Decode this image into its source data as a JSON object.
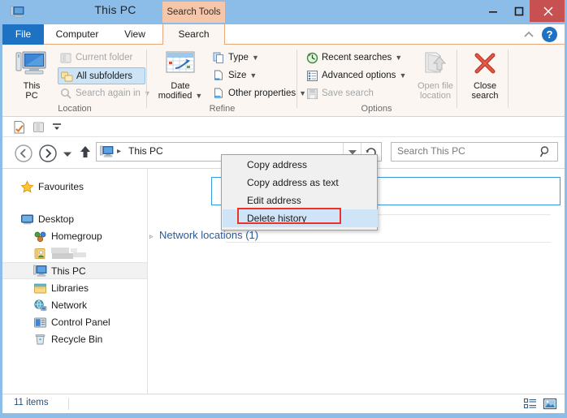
{
  "window": {
    "title": "This PC",
    "contextual_tab_header": "Search Tools",
    "icon": "this-pc-icon",
    "controls": {
      "minimize": "Minimize",
      "maximize": "Maximize",
      "close": "Close"
    },
    "help_label": "?",
    "accent_color": "#8cbde8",
    "close_color": "#c75050",
    "contextual_color": "#f6c6ab"
  },
  "tabs": [
    {
      "label": "File",
      "active": false,
      "style": "file"
    },
    {
      "label": "Computer",
      "active": false,
      "style": "normal"
    },
    {
      "label": "View",
      "active": false,
      "style": "normal"
    },
    {
      "label": "Search",
      "active": true,
      "style": "contextual"
    }
  ],
  "ribbon": {
    "groups": [
      {
        "name": "Location",
        "label": "Location",
        "big_button": {
          "label_line1": "This",
          "label_line2": "PC",
          "icon": "this-pc-icon"
        },
        "items": [
          {
            "label": "Current folder",
            "icon": "folder-icon",
            "disabled": true,
            "caret": false
          },
          {
            "label": "All subfolders",
            "icon": "subfolders-icon",
            "disabled": false,
            "caret": false,
            "checked": true
          },
          {
            "label": "Search again in",
            "icon": "search-again-icon",
            "disabled": true,
            "caret": true
          }
        ]
      },
      {
        "name": "Refine",
        "label": "Refine",
        "big_button": {
          "label_line1": "Date",
          "label_line2": "modified",
          "icon": "calendar-icon",
          "caret": true
        },
        "items": [
          {
            "label": "Type",
            "icon": "type-icon",
            "disabled": false,
            "caret": true
          },
          {
            "label": "Size",
            "icon": "size-icon",
            "disabled": false,
            "caret": true
          },
          {
            "label": "Other properties",
            "icon": "properties-icon",
            "disabled": false,
            "caret": true
          }
        ]
      },
      {
        "name": "Options",
        "label": "Options",
        "items": [
          {
            "label": "Recent searches",
            "icon": "recent-searches-icon",
            "disabled": false,
            "caret": true
          },
          {
            "label": "Advanced options",
            "icon": "advanced-options-icon",
            "disabled": false,
            "caret": true
          },
          {
            "label": "Save search",
            "icon": "save-icon",
            "disabled": true,
            "caret": false
          }
        ],
        "buttons": [
          {
            "label_line1": "Open file",
            "label_line2": "location",
            "icon": "open-file-location-icon",
            "disabled": true
          },
          {
            "label_line1": "Close",
            "label_line2": "search",
            "icon": "close-search-icon",
            "disabled": false
          }
        ]
      }
    ]
  },
  "quick_access": {
    "items": [
      {
        "name": "properties-icon",
        "label": "Properties"
      },
      {
        "name": "new-folder-icon",
        "label": "New folder"
      },
      {
        "name": "customize-dropdown-icon",
        "label": "Customize Quick Access Toolbar"
      }
    ]
  },
  "navigation": {
    "back": "Back",
    "forward": "Forward",
    "recent_dropdown": "Recent locations",
    "up": "Up",
    "address": {
      "icon": "this-pc-icon",
      "separator": "▸",
      "crumb": "This PC",
      "dropdown": "Previous locations",
      "refresh": "Refresh"
    },
    "search": {
      "placeholder": "Search This PC",
      "icon": "search-icon"
    }
  },
  "nav_pane": {
    "items": [
      {
        "label": "Favourites",
        "icon": "star-icon",
        "indent": 0,
        "selected": false,
        "blurred": false
      },
      {
        "label": "Desktop",
        "icon": "desktop-icon",
        "indent": 0,
        "selected": false,
        "blurred": false
      },
      {
        "label": "Homegroup",
        "icon": "homegroup-icon",
        "indent": 1,
        "selected": false,
        "blurred": false
      },
      {
        "label": "",
        "icon": "user-folder-icon",
        "indent": 1,
        "selected": false,
        "blurred": true
      },
      {
        "label": "This PC",
        "icon": "this-pc-icon",
        "indent": 1,
        "selected": true,
        "blurred": false
      },
      {
        "label": "Libraries",
        "icon": "libraries-icon",
        "indent": 1,
        "selected": false,
        "blurred": false
      },
      {
        "label": "Network",
        "icon": "network-icon",
        "indent": 1,
        "selected": false,
        "blurred": false
      },
      {
        "label": "Control Panel",
        "icon": "control-panel-icon",
        "indent": 1,
        "selected": false,
        "blurred": false
      },
      {
        "label": "Recycle Bin",
        "icon": "recycle-bin-icon",
        "indent": 1,
        "selected": false,
        "blurred": false
      }
    ]
  },
  "content": {
    "group_header": "Network locations (1)",
    "group_chevron": "▹"
  },
  "context_menu": {
    "items": [
      {
        "label": "Copy address",
        "hover": false
      },
      {
        "label": "Copy address as text",
        "hover": false
      },
      {
        "label": "Edit address",
        "hover": false
      },
      {
        "label": "Delete history",
        "hover": true,
        "highlighted": true
      }
    ],
    "highlight_color": "#ee3124"
  },
  "status_bar": {
    "item_count": "11 items",
    "views": [
      {
        "name": "details-view-icon",
        "label": "Details view",
        "active": false
      },
      {
        "name": "large-icons-view-icon",
        "label": "Large icons view",
        "active": true
      }
    ]
  }
}
